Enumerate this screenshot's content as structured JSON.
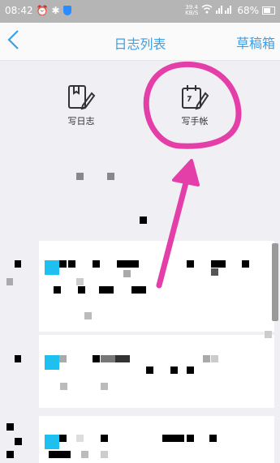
{
  "status_bar": {
    "time": "08:42",
    "speed_value": "39.4",
    "speed_unit": "KB/S",
    "battery": "68%"
  },
  "nav": {
    "title": "日志列表",
    "draft_label": "草稿箱"
  },
  "tools": {
    "write_diary": "写日志",
    "write_handbook": "写手帐"
  },
  "colors": {
    "accent": "#3aa0e8",
    "annotation": "#e43fa8"
  }
}
